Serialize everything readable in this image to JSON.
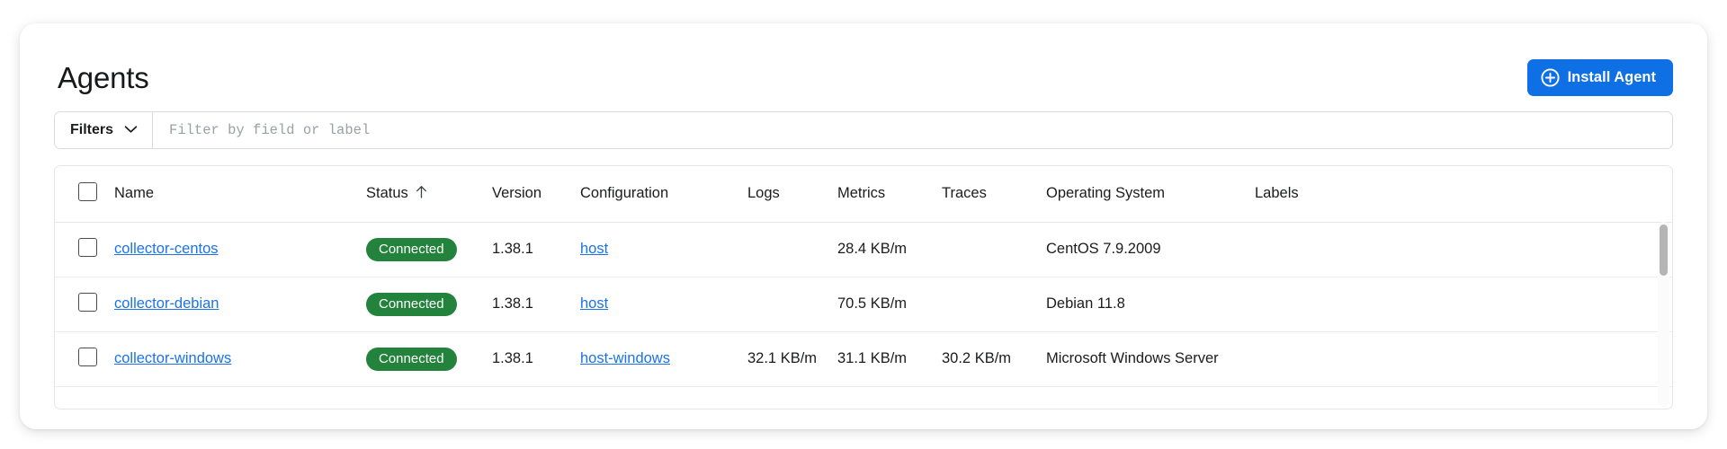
{
  "header": {
    "title": "Agents",
    "install_button": {
      "label": "Install Agent",
      "icon": "plus-circle-icon",
      "color": "#0f6fe5"
    }
  },
  "filter_bar": {
    "filters_label": "Filters",
    "filters_icon": "chevron-down-icon",
    "input_value": "",
    "input_placeholder": "Filter by field or label"
  },
  "table": {
    "select_all_checkbox": false,
    "sort": {
      "column": "Status",
      "direction": "asc",
      "icon": "arrow-up-icon"
    },
    "columns": [
      {
        "key": "name",
        "label": "Name"
      },
      {
        "key": "status",
        "label": "Status"
      },
      {
        "key": "version",
        "label": "Version"
      },
      {
        "key": "configuration",
        "label": "Configuration"
      },
      {
        "key": "logs",
        "label": "Logs"
      },
      {
        "key": "metrics",
        "label": "Metrics"
      },
      {
        "key": "traces",
        "label": "Traces"
      },
      {
        "key": "operating_system",
        "label": "Operating System"
      },
      {
        "key": "labels",
        "label": "Labels"
      }
    ],
    "status_pill_color": "#23823c",
    "link_color": "#1a73e8",
    "rows": [
      {
        "checked": false,
        "name": "collector-centos",
        "status": "Connected",
        "version": "1.38.1",
        "configuration": "host",
        "logs": "",
        "metrics": "28.4 KB/m",
        "traces": "",
        "operating_system": "CentOS 7.9.2009",
        "labels": ""
      },
      {
        "checked": false,
        "name": "collector-debian",
        "status": "Connected",
        "version": "1.38.1",
        "configuration": "host",
        "logs": "",
        "metrics": "70.5 KB/m",
        "traces": "",
        "operating_system": "Debian 11.8",
        "labels": ""
      },
      {
        "checked": false,
        "name": "collector-windows",
        "status": "Connected",
        "version": "1.38.1",
        "configuration": "host-windows",
        "logs": "32.1 KB/m",
        "metrics": "31.1 KB/m",
        "traces": "30.2 KB/m",
        "operating_system": "Microsoft Windows Server",
        "labels": ""
      }
    ]
  }
}
